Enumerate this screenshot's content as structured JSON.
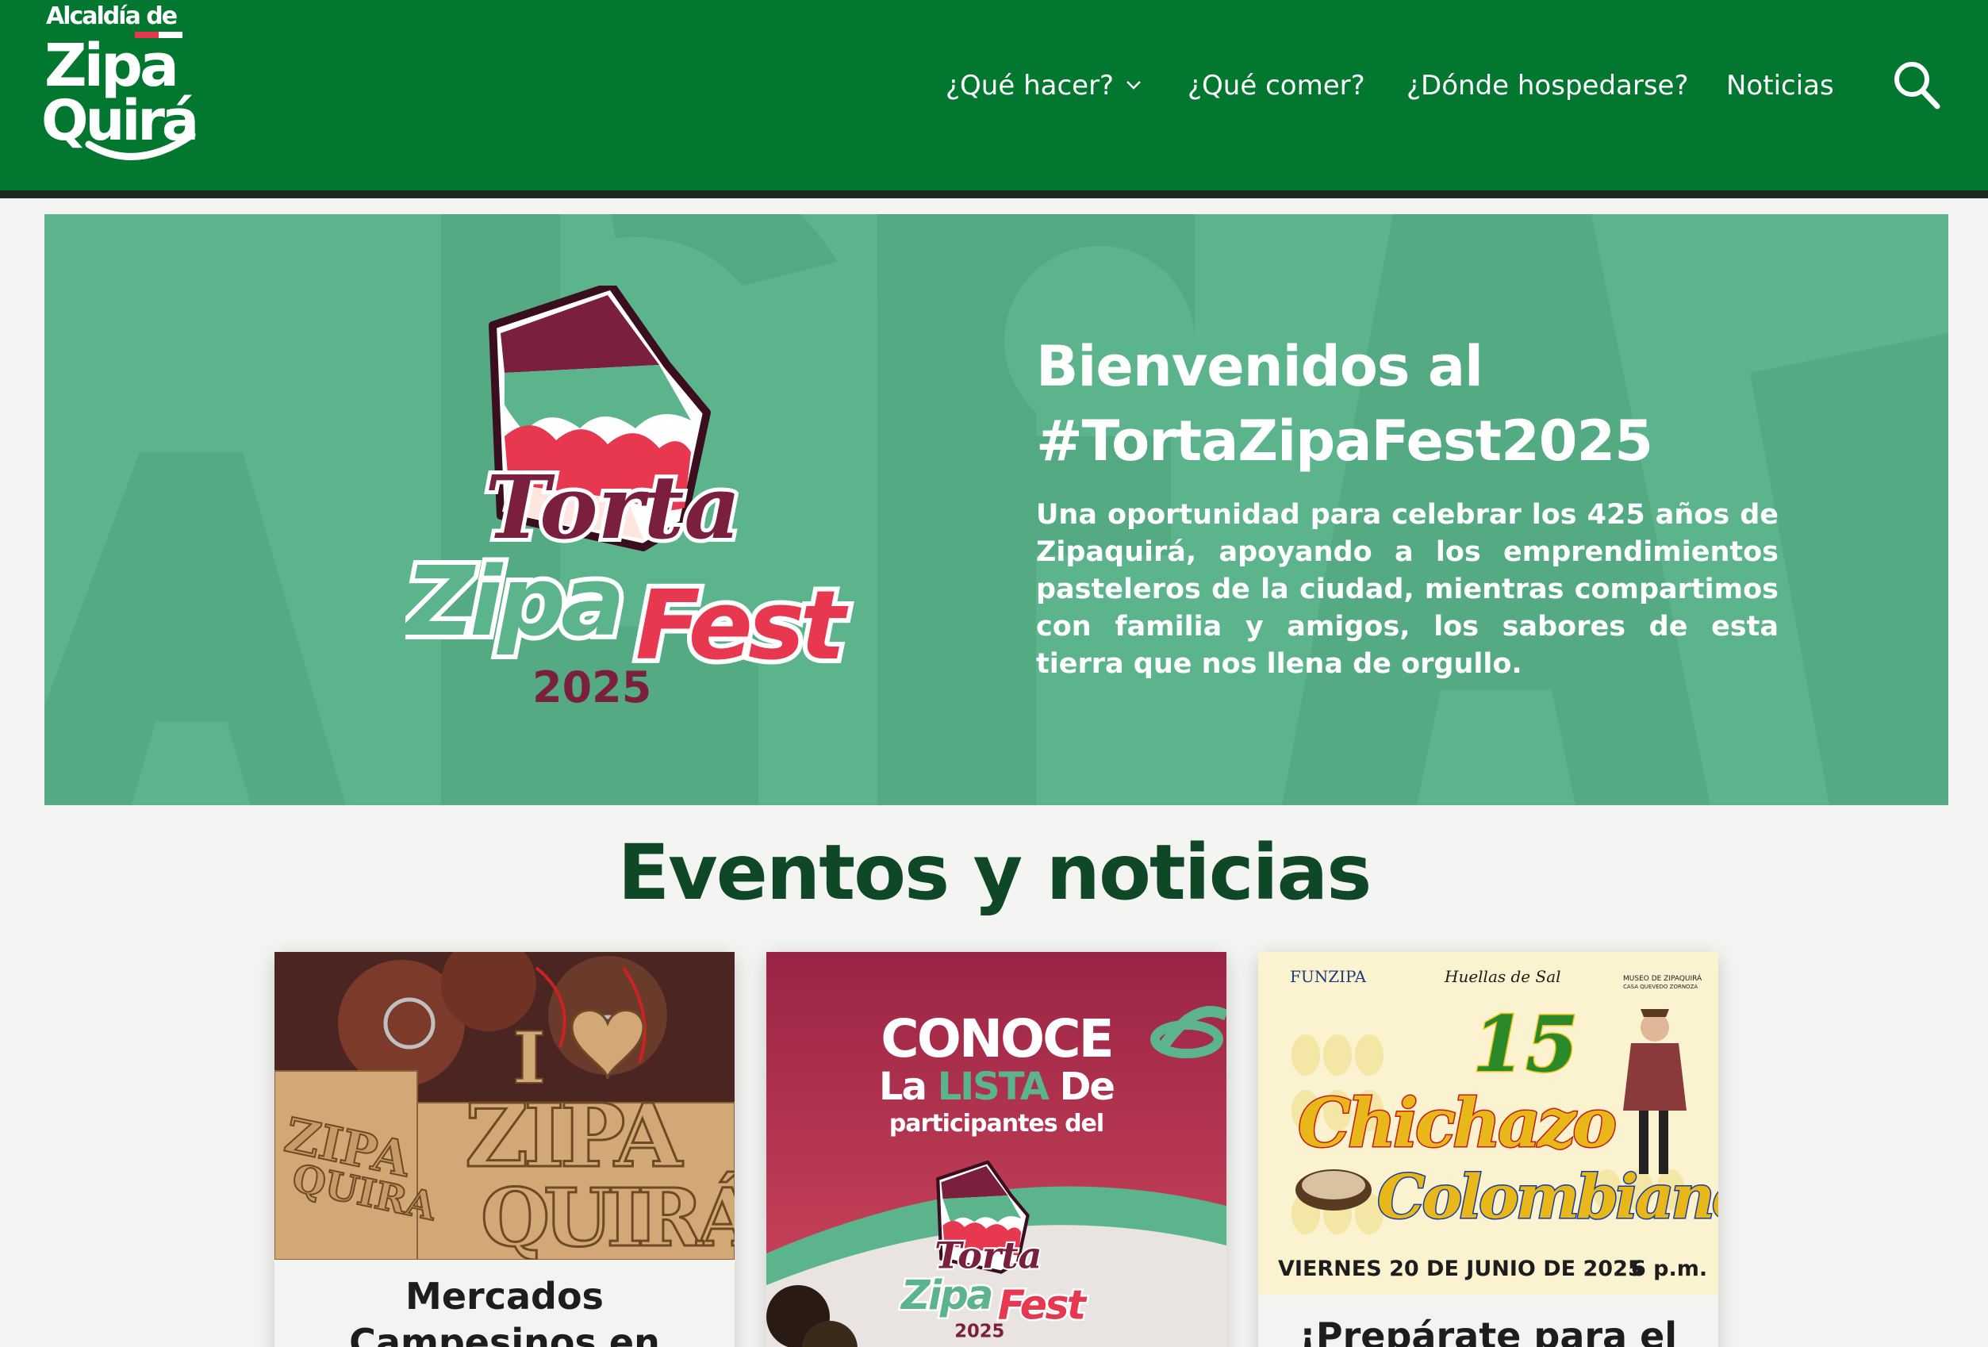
{
  "header": {
    "logo": {
      "line1": "Alcaldía de",
      "line2": "Zipa",
      "line3": "Quirá"
    },
    "nav": [
      {
        "label": "¿Qué hacer?",
        "has_dropdown": true
      },
      {
        "label": "¿Qué comer?"
      },
      {
        "label": "¿Dónde hospedarse?"
      },
      {
        "label": "Noticias"
      }
    ],
    "search_icon": "search-icon"
  },
  "hero": {
    "logo_text": {
      "torta": "Torta",
      "zipa": "Zipa",
      "fest": "Fest",
      "year": "2025"
    },
    "title_line1": "Bienvenidos al",
    "title_line2": "#TortaZipaFest2025",
    "description": "Una oportunidad para celebrar los 425 años de Zipaquirá, apoyando a los emprendimientos pasteleros de la ciudad, mientras compartimos con familia y amigos, los sabores de esta tierra que nos llena de orgullo."
  },
  "section": {
    "title": "Eventos y noticias"
  },
  "cards": [
    {
      "image_text": {
        "heart_prefix": "I",
        "word1": "ZIPA",
        "word2": "QUIRÁ",
        "word3": "ZIPA",
        "word4": "QUIRA"
      },
      "title_line1": "Mercados",
      "title_line2": "Campesinos en"
    },
    {
      "image_text": {
        "line1": "CONOCE",
        "line2a": "La ",
        "line2b": "LISTA",
        "line2c": " De",
        "line3": "participantes del",
        "torta": "Torta",
        "zipa": "Zipa",
        "fest": "Fest",
        "year": "2025"
      },
      "title_line1": ""
    },
    {
      "image_text": {
        "org1": "FUNZIPA",
        "org2": "Huellas de Sal",
        "org3": "MUSEO DE ZIPAQUIRÁ",
        "org3b": "CASA QUEVEDO ZORNOZA",
        "number": "15",
        "word1": "Chichazo",
        "word2": "Colombiano",
        "date": "VIERNES 20 DE JUNIO DE 2025",
        "time": "6 p.m."
      },
      "title_line1": "¡Prepárate para el"
    }
  ],
  "colors": {
    "header_green": "#02772f",
    "hero_green": "#5cb48c",
    "title_dark_green": "#0f4826",
    "cake_maroon": "#7a1f3d",
    "fest_red": "#e8384f"
  }
}
